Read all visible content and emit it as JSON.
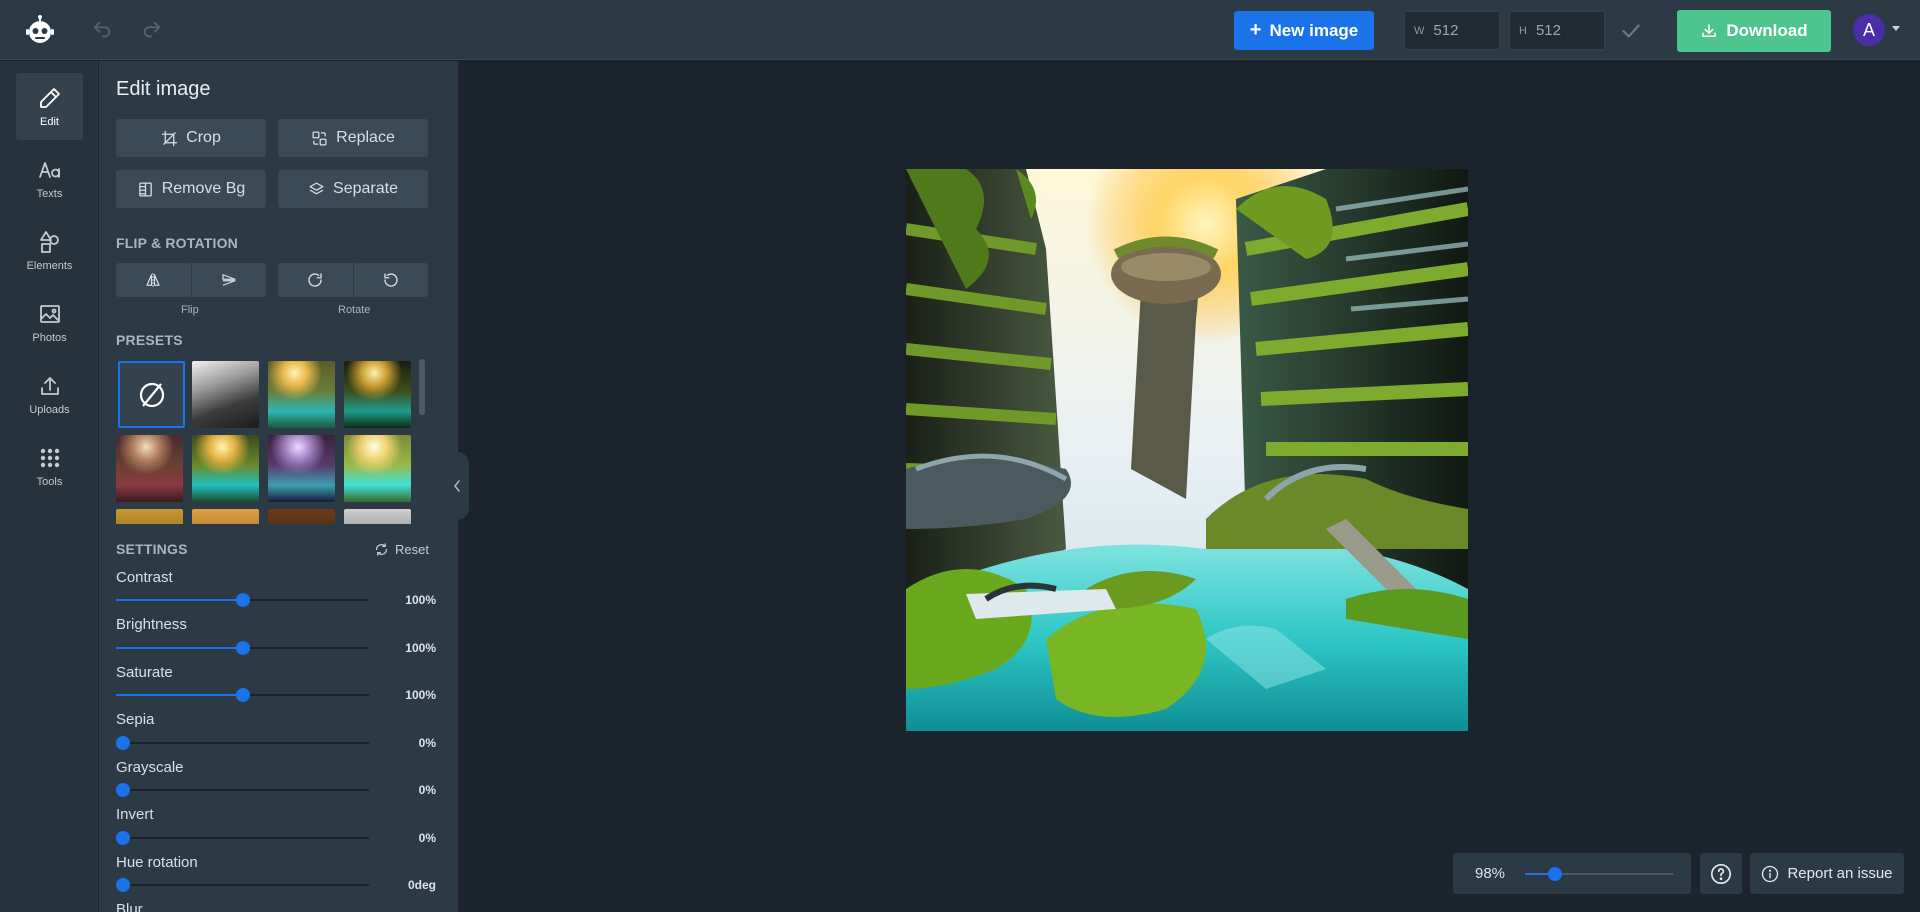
{
  "header": {
    "logo_icon": "robot-logo-icon",
    "new_image_label": "New image",
    "width_label": "W",
    "width_value": "512",
    "height_label": "H",
    "height_value": "512",
    "download_label": "Download",
    "avatar_initial": "A"
  },
  "rail": {
    "items": [
      {
        "label": "Edit",
        "icon": "pencil-icon",
        "active": true
      },
      {
        "label": "Texts",
        "icon": "text-icon"
      },
      {
        "label": "Elements",
        "icon": "shapes-icon"
      },
      {
        "label": "Photos",
        "icon": "image-icon"
      },
      {
        "label": "Uploads",
        "icon": "upload-icon"
      },
      {
        "label": "Tools",
        "icon": "grid-icon"
      }
    ]
  },
  "panel": {
    "title": "Edit image",
    "actions": {
      "crop": "Crop",
      "replace": "Replace",
      "remove_bg": "Remove Bg",
      "separate": "Separate"
    },
    "flip_rotation": {
      "heading": "FLIP & ROTATION",
      "flip_caption": "Flip",
      "rotate_caption": "Rotate"
    },
    "presets": {
      "heading": "PRESETS"
    },
    "settings": {
      "heading": "SETTINGS",
      "reset_label": "Reset",
      "items": [
        {
          "label": "Contrast",
          "value": "100%",
          "level": 0.5
        },
        {
          "label": "Brightness",
          "value": "100%",
          "level": 0.5
        },
        {
          "label": "Saturate",
          "value": "100%",
          "level": 0.5
        },
        {
          "label": "Sepia",
          "value": "0%",
          "level": 0
        },
        {
          "label": "Grayscale",
          "value": "0%",
          "level": 0
        },
        {
          "label": "Invert",
          "value": "0%",
          "level": 0
        },
        {
          "label": "Hue rotation",
          "value": "0deg",
          "level": 0
        },
        {
          "label": "Blur",
          "value": "",
          "level": 0
        }
      ]
    }
  },
  "zoom": {
    "value": "98%",
    "level": 0.2
  },
  "help_icon": "question-circle-icon",
  "report_label": "Report an issue",
  "colors": {
    "accent": "#1a73e8",
    "download": "#4ec58e",
    "avatar": "#4a2ea8"
  }
}
